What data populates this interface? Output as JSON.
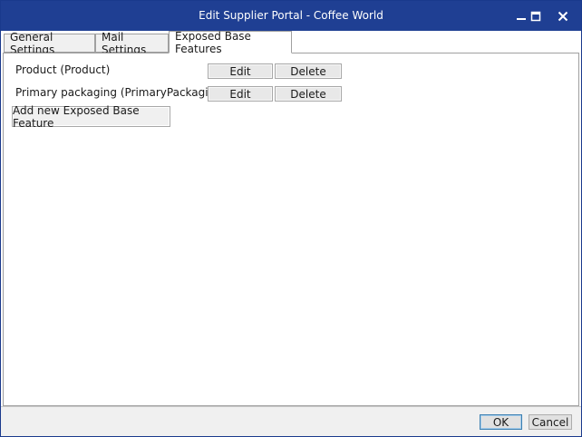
{
  "window": {
    "title": "Edit Supplier Portal - Coffee World",
    "minimize_icon": "minimize-icon",
    "maximize_icon": "maximize-icon",
    "close_icon": "close-icon"
  },
  "tabs": [
    {
      "label": "General Settings",
      "active": false
    },
    {
      "label": "Mail Settings",
      "active": false
    },
    {
      "label": "Exposed Base Features",
      "active": true
    }
  ],
  "features": [
    {
      "label": "Product (Product)",
      "edit_label": "Edit",
      "delete_label": "Delete"
    },
    {
      "label": "Primary packaging (PrimaryPackaging)",
      "edit_label": "Edit",
      "delete_label": "Delete"
    }
  ],
  "add_button_label": "Add new Exposed Base Feature",
  "footer": {
    "ok_label": "OK",
    "cancel_label": "Cancel"
  },
  "colors": {
    "titlebar": "#1f3f93",
    "accent": "#3c7fb1"
  }
}
